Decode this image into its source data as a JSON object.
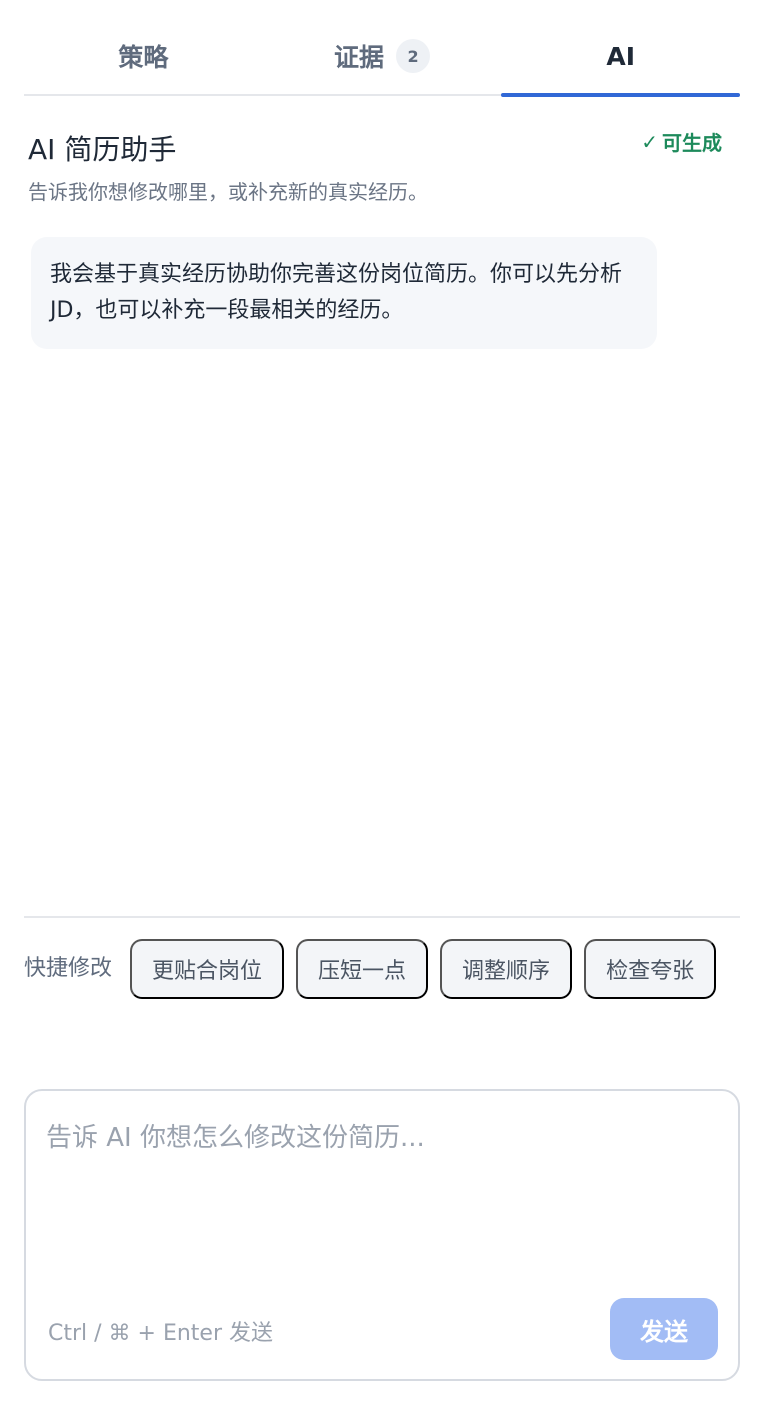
{
  "tabs": [
    {
      "label": "策略"
    },
    {
      "label": "证据",
      "badge": "2"
    },
    {
      "label": "AI"
    }
  ],
  "panel": {
    "title": "AI 简历助手",
    "status": "可生成",
    "status_mark": "✓",
    "subtitle": "告诉我你想修改哪里，或补充新的真实经历。"
  },
  "messages": [
    {
      "role": "assistant",
      "text": "我会基于真实经历协助你完善这份岗位简历。你可以先分析 JD，也可以补充一段最相关的经历。"
    }
  ],
  "quick_actions": {
    "label": "快捷修改",
    "items": [
      {
        "label": "更贴合岗位"
      },
      {
        "label": "压短一点"
      },
      {
        "label": "调整顺序"
      },
      {
        "label": "检查夸张"
      }
    ]
  },
  "composer": {
    "placeholder": "告诉 AI 你想怎么修改这份简历...",
    "value": "",
    "hint": "Ctrl / ⌘ + Enter 发送",
    "send_label": "发送"
  },
  "colors": {
    "accent": "#3168d6",
    "status_green": "#1d8a5b",
    "send_disabled": "#a2bcf5"
  }
}
